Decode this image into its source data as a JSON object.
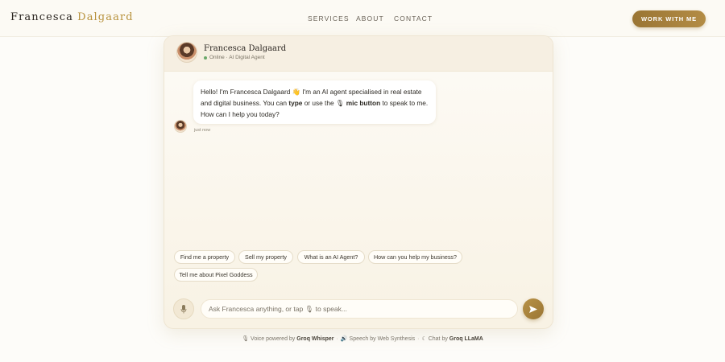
{
  "nav": {
    "brand_first": "Francesca",
    "brand_last": "Dalgaard",
    "menu": [
      "SERVICES",
      "ABOUT",
      "CONTACT"
    ],
    "cta": "WORK WITH ME"
  },
  "chat": {
    "agent_name": "Francesca Dalgaard",
    "status": "Online · AI Digital Agent",
    "status_color": "#6aa86a",
    "message": {
      "part1": "Hello! I'm Francesca Dalgaard 👋 I'm an AI agent specialised in real estate and digital business. You can ",
      "bold1": "type",
      "part2": " or use the ",
      "icon": "🎙",
      "bold2": "mic button",
      "part3": " to speak to me. How can I help you today?"
    },
    "timestamp": "just now",
    "suggestions": [
      "Find me a property",
      "Sell my property",
      "What is an AI Agent?",
      "How can you help my business?",
      "Tell me about Pixel Goddess"
    ],
    "input_placeholder": "Ask Francesca anything, or tap 🎙 to speak...",
    "mic_icon": "microphone-icon",
    "send_icon": "send-icon"
  },
  "footer": {
    "voice_icon": "🎙",
    "voice_prefix": "Voice powered by ",
    "voice_bold": "Groq Whisper",
    "speech_icon": "🔊",
    "speech_text": "Speech by Web Synthesis",
    "chat_icon": "☾",
    "chat_prefix": "Chat by ",
    "chat_bold": "Groq LLaMA"
  },
  "colors": {
    "accent": "#b38c45",
    "background": "#fdfcf9"
  }
}
